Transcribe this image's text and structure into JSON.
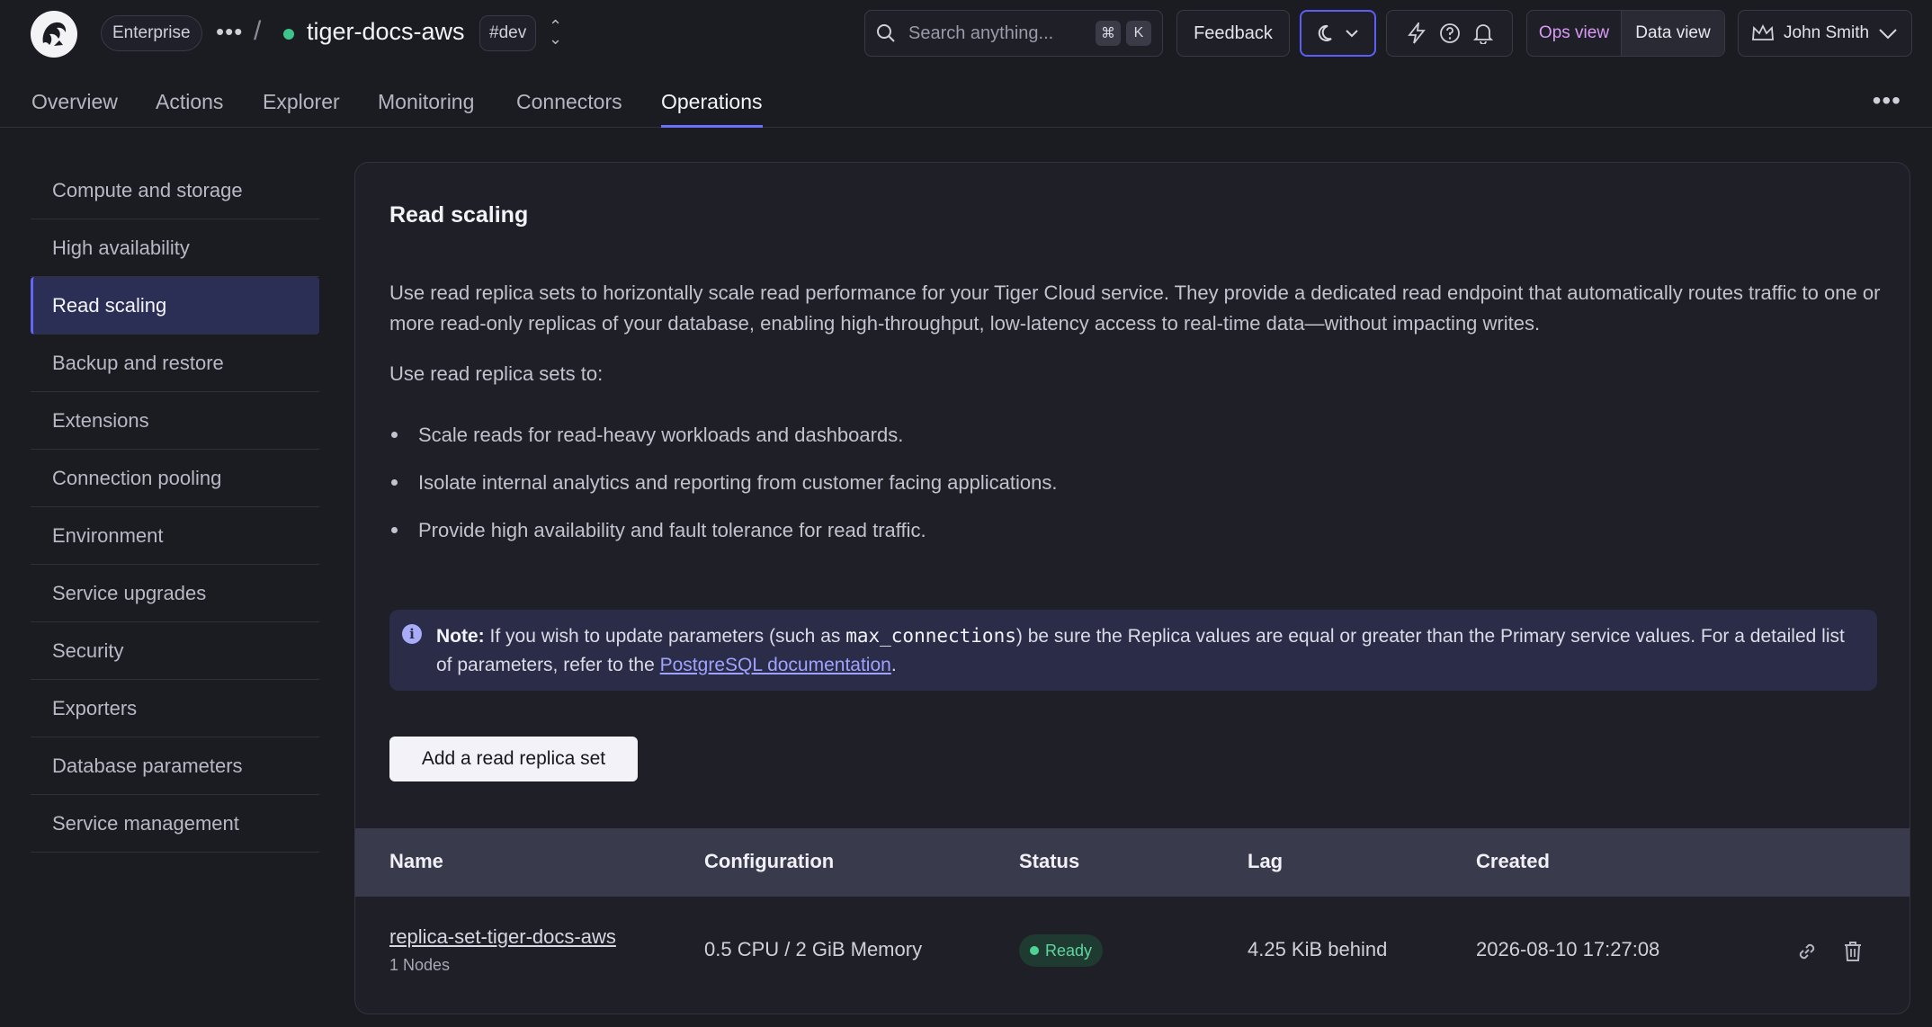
{
  "header": {
    "org_label": "Enterprise",
    "service_name": "tiger-docs-aws",
    "env_tag": "#dev",
    "search_placeholder": "Search anything...",
    "search_shortcut_mod": "⌘",
    "search_shortcut_key": "K",
    "feedback_label": "Feedback",
    "ops_view_label": "Ops view",
    "data_view_label": "Data view",
    "user_name": "John Smith"
  },
  "tabs": [
    "Overview",
    "Actions",
    "Explorer",
    "Monitoring",
    "Connectors",
    "Operations"
  ],
  "active_tab": "Operations",
  "sidebar": {
    "items": [
      "Compute and storage",
      "High availability",
      "Read scaling",
      "Backup and restore",
      "Extensions",
      "Connection pooling",
      "Environment",
      "Service upgrades",
      "Security",
      "Exporters",
      "Database parameters",
      "Service management"
    ],
    "active": "Read scaling"
  },
  "main": {
    "title": "Read scaling",
    "description": "Use read replica sets to horizontally scale read performance for your Tiger Cloud service. They provide a dedicated read endpoint that automatically routes traffic to one or more read-only replicas of your database, enabling high-throughput, low-latency access to real-time data—without impacting writes.",
    "intro": "Use read replica sets to:",
    "bullets": [
      "Scale reads for read-heavy workloads and dashboards.",
      "Isolate internal analytics and reporting from customer facing applications.",
      "Provide high availability and fault tolerance for read traffic."
    ],
    "note": {
      "label": "Note:",
      "text_before": " If you wish to update parameters (such as ",
      "code": "max_connections",
      "text_after": ") be sure the Replica values are equal or greater than the Primary service values. For a detailed list of parameters, refer to the ",
      "link": "PostgreSQL documentation",
      "end": "."
    },
    "add_button": "Add a read replica set",
    "table": {
      "columns": [
        "Name",
        "Configuration",
        "Status",
        "Lag",
        "Created"
      ],
      "rows": [
        {
          "name": "replica-set-tiger-docs-aws",
          "nodes": "1 Nodes",
          "configuration": "0.5 CPU / 2 GiB Memory",
          "status": "Ready",
          "lag": "4.25 KiB behind",
          "created": "2026-08-10 17:27:08"
        }
      ]
    }
  },
  "colors": {
    "accent": "#6366f1",
    "ops_view": "#d99bf5",
    "status_ready": "#4ed395",
    "link": "#9fa3ff"
  }
}
